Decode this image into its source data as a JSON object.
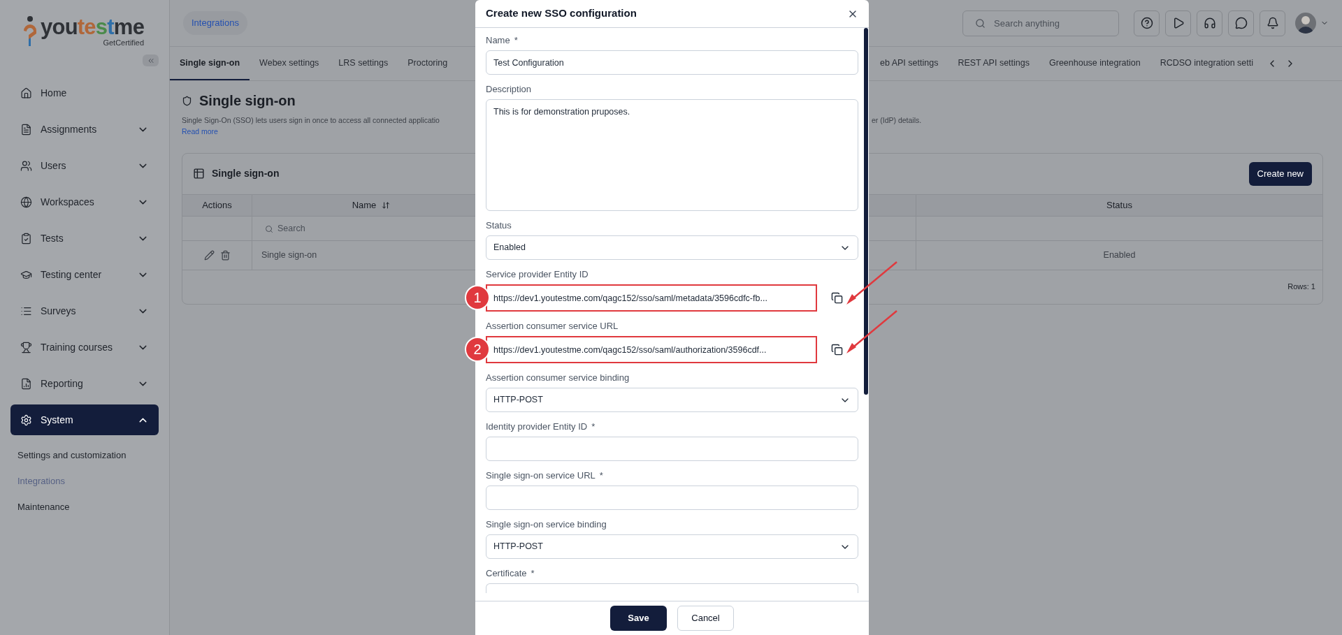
{
  "sidebar": {
    "logo": {
      "parts": [
        {
          "text": "you",
          "color": "#2f3237"
        },
        {
          "text": "te",
          "color": "#b0673a"
        },
        {
          "text": "s",
          "color": "#4a8a4a"
        },
        {
          "text": "t",
          "color": "#2f6fa8"
        },
        {
          "text": "me",
          "color": "#2f3237"
        }
      ],
      "tagline": "GetCertified"
    },
    "items": [
      {
        "label": "Home",
        "selected": false
      },
      {
        "label": "Assignments",
        "expanded": false,
        "selected": false
      },
      {
        "label": "Users",
        "expanded": false,
        "selected": false
      },
      {
        "label": "Workspaces",
        "expanded": false,
        "selected": false
      },
      {
        "label": "Tests",
        "expanded": false,
        "selected": false
      },
      {
        "label": "Testing center",
        "expanded": false,
        "selected": false
      },
      {
        "label": "Surveys",
        "expanded": false,
        "selected": false
      },
      {
        "label": "Training courses",
        "expanded": false,
        "selected": false
      },
      {
        "label": "Reporting",
        "expanded": false,
        "selected": false
      },
      {
        "label": "System",
        "expanded": true,
        "selected": true,
        "children": [
          {
            "label": "Settings and customization",
            "selected": false
          },
          {
            "label": "Integrations",
            "selected": true
          },
          {
            "label": "Maintenance",
            "selected": false
          }
        ]
      }
    ]
  },
  "header": {
    "breadcrumb": "Integrations",
    "search": {
      "placeholder": "Search anything"
    }
  },
  "tabs": [
    {
      "label": "Single sign-on",
      "selected": true
    },
    {
      "label": "Webex settings",
      "selected": false
    },
    {
      "label": "LRS settings",
      "selected": false
    },
    {
      "label": "Proctoring",
      "selected": false
    },
    {
      "label": "eb API settings",
      "selected": false
    },
    {
      "label": "REST API settings",
      "selected": false
    },
    {
      "label": "Greenhouse integration",
      "selected": false
    },
    {
      "label": "RCDSO integration setti",
      "selected": false
    }
  ],
  "page": {
    "title": "Single sign-on",
    "description": [
      "Single Sign-On (SSO) lets users sign in once to access all connected applicatio",
      "er (IdP) details."
    ],
    "read_more": "Read more"
  },
  "card": {
    "title": "Single sign-on",
    "create_button": "Create new",
    "columns": [
      {
        "label": "Actions",
        "sortable": false
      },
      {
        "label": "Name",
        "sortable": true
      },
      {
        "label": "Status",
        "sortable": false
      }
    ],
    "search": {
      "placeholder": "Search"
    },
    "rows": [
      {
        "name": "Single sign-on",
        "status": "Enabled"
      }
    ],
    "row_count": "Rows: 1"
  },
  "dialog": {
    "title": "Create new SSO configuration",
    "fields": [
      {
        "kind": "text",
        "label": "Name",
        "required_mark": "*",
        "value": "Test Configuration"
      },
      {
        "kind": "textarea",
        "label": "Description",
        "value": "This is for demonstration pruposes."
      },
      {
        "kind": "select",
        "label": "Status",
        "value": "Enabled"
      },
      {
        "kind": "copy",
        "label": "Service provider Entity ID",
        "value": "https://dev1.youtestme.com/qagc152/sso/saml/metadata/3596cdfc-fb...",
        "marker": "1"
      },
      {
        "kind": "copy",
        "label": "Assertion consumer service URL",
        "value": "https://dev1.youtestme.com/qagc152/sso/saml/authorization/3596cdf...",
        "marker": "2"
      },
      {
        "kind": "select",
        "label": "Assertion consumer service binding",
        "value": "HTTP-POST"
      },
      {
        "kind": "text",
        "label": "Identity provider Entity ID",
        "required_mark": "*"
      },
      {
        "kind": "text",
        "label": "Single sign-on service URL",
        "required_mark": "*"
      },
      {
        "kind": "select",
        "label": "Single sign-on service binding",
        "value": "HTTP-POST"
      },
      {
        "kind": "cut",
        "label": "Certificate",
        "required_mark": "*"
      }
    ],
    "buttons": [
      {
        "label": "Save",
        "primary": true
      },
      {
        "label": "Cancel",
        "primary": false
      }
    ]
  }
}
